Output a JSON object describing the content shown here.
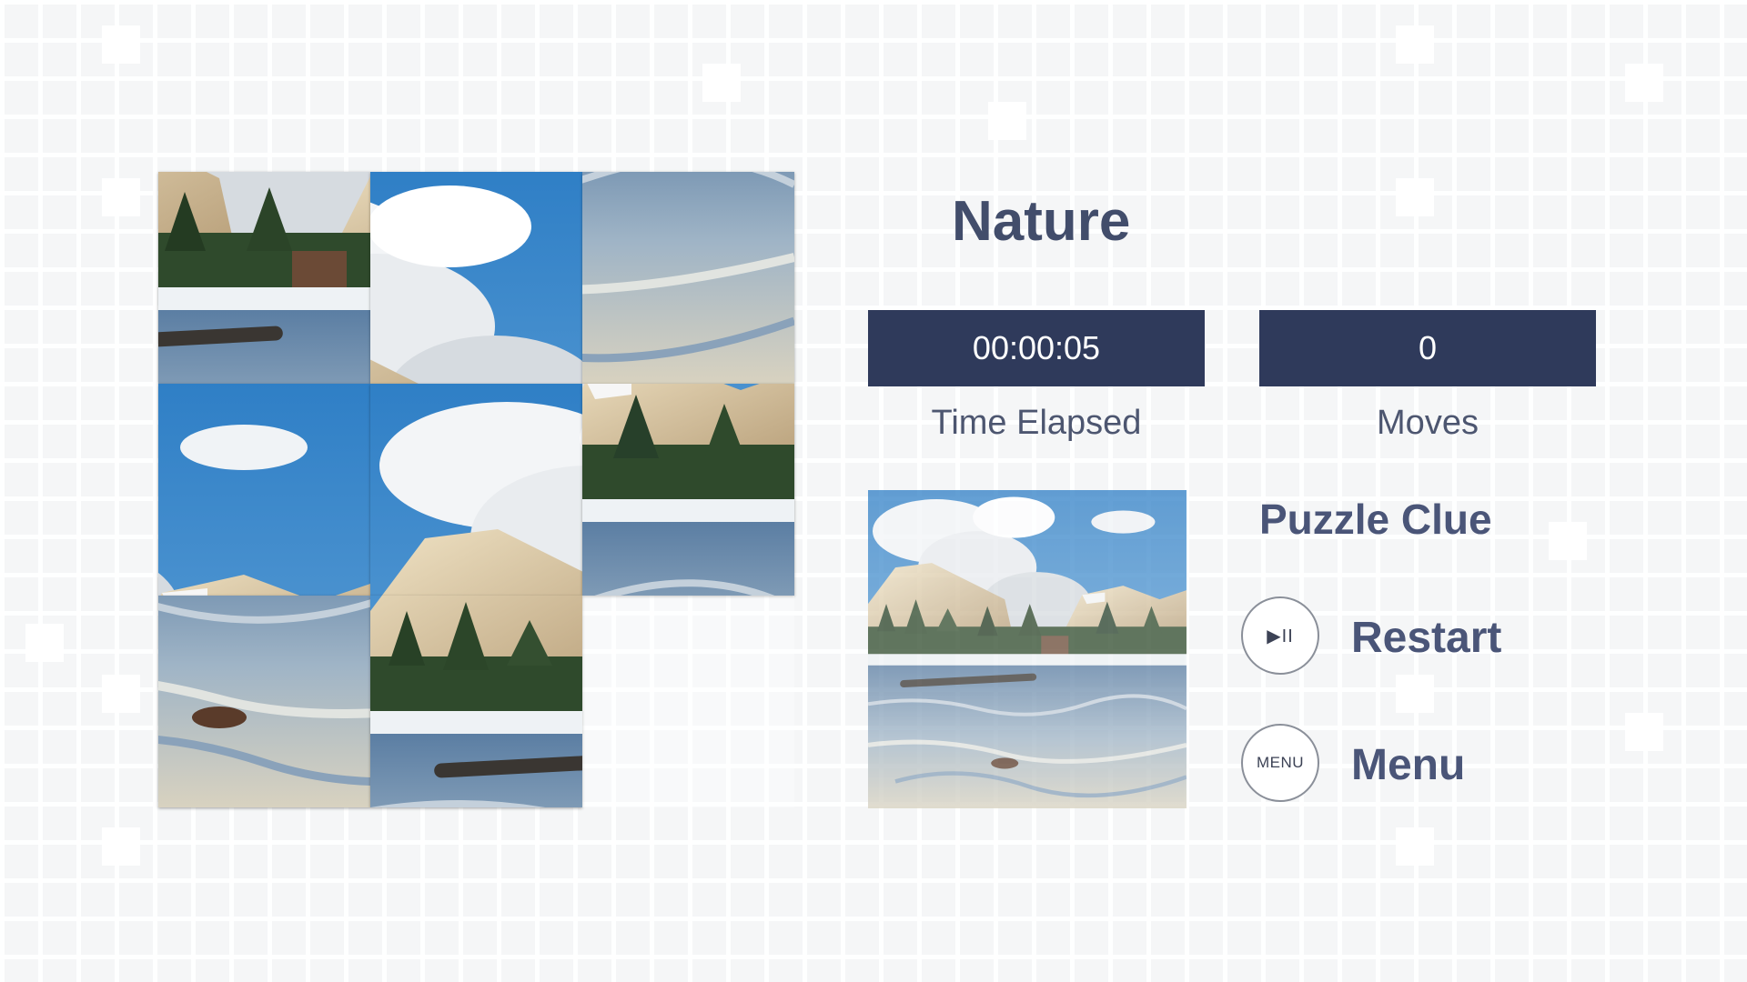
{
  "game": {
    "title": "Nature"
  },
  "stats": {
    "time_elapsed": "00:00:05",
    "time_label": "Time Elapsed",
    "moves": "0",
    "moves_label": "Moves"
  },
  "clue": {
    "heading": "Puzzle Clue"
  },
  "actions": {
    "restart_glyph": "▶II",
    "restart_label": "Restart",
    "menu_glyph": "MENU",
    "menu_label": "Menu"
  },
  "board": {
    "rows": 3,
    "cols": 3,
    "tiles": [
      {
        "row": 1,
        "col": 1,
        "piece": 4
      },
      {
        "row": 1,
        "col": 2,
        "piece": 1
      },
      {
        "row": 1,
        "col": 3,
        "piece": 8
      },
      {
        "row": 2,
        "col": 1,
        "piece": 2
      },
      {
        "row": 2,
        "col": 2,
        "piece": 0
      },
      {
        "row": 2,
        "col": 3,
        "piece": 5
      },
      {
        "row": 3,
        "col": 1,
        "piece": 7
      },
      {
        "row": 3,
        "col": 2,
        "piece": 3
      },
      {
        "row": 3,
        "col": 3,
        "piece": null
      }
    ]
  },
  "colors": {
    "background": "#f5f6f7",
    "title": "#424d6b",
    "stat_box": "#2f3a5b",
    "stat_text": "#ffffff",
    "label": "#4a5578",
    "sky": "#3f8fd0",
    "cliff": "#d9c7a3",
    "forest": "#2f4a2c",
    "water": "#4a6a8e",
    "snow": "#eef2f5"
  },
  "icons": {
    "restart": "play-pause-icon",
    "menu": "menu-icon"
  }
}
